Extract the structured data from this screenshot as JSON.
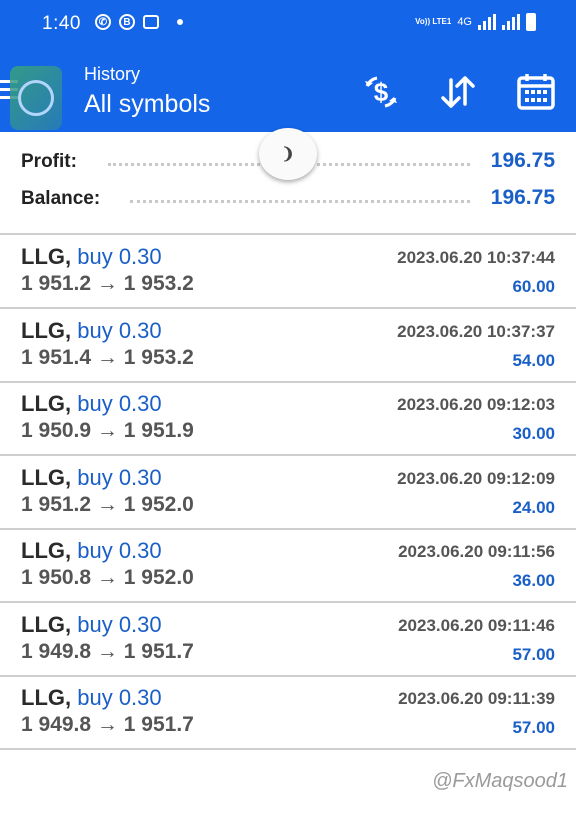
{
  "status_bar": {
    "time": "1:40",
    "network": "4G",
    "volte": "Vo)) LTE1"
  },
  "header": {
    "subtitle": "History",
    "title": "All symbols",
    "icons": [
      "menu-icon",
      "currency-exchange-icon",
      "sort-icon",
      "calendar-icon"
    ]
  },
  "summary": {
    "profit_label": "Profit:",
    "profit_value": "196.75",
    "balance_label": "Balance:",
    "balance_value": "196.75"
  },
  "trades": [
    {
      "symbol": "LLG,",
      "type": "buy 0.30",
      "open": "1 951.2",
      "close": "1 953.2",
      "time": "2023.06.20 10:37:44",
      "profit": "60.00"
    },
    {
      "symbol": "LLG,",
      "type": "buy 0.30",
      "open": "1 951.4",
      "close": "1 953.2",
      "time": "2023.06.20 10:37:37",
      "profit": "54.00"
    },
    {
      "symbol": "LLG,",
      "type": "buy 0.30",
      "open": "1 950.9",
      "close": "1 951.9",
      "time": "2023.06.20 09:12:03",
      "profit": "30.00"
    },
    {
      "symbol": "LLG,",
      "type": "buy 0.30",
      "open": "1 951.2",
      "close": "1 952.0",
      "time": "2023.06.20 09:12:09",
      "profit": "24.00"
    },
    {
      "symbol": "LLG,",
      "type": "buy 0.30",
      "open": "1 950.8",
      "close": "1 952.0",
      "time": "2023.06.20 09:11:56",
      "profit": "36.00"
    },
    {
      "symbol": "LLG,",
      "type": "buy 0.30",
      "open": "1 949.8",
      "close": "1 951.7",
      "time": "2023.06.20 09:11:46",
      "profit": "57.00"
    },
    {
      "symbol": "LLG,",
      "type": "buy 0.30",
      "open": "1 949.8",
      "close": "1 951.7",
      "time": "2023.06.20 09:11:39",
      "profit": "57.00"
    }
  ],
  "arrow": "→",
  "watermark": "@FxMaqsood1",
  "colors": {
    "header": "#1565e8",
    "accent": "#1a5fc7",
    "text": "#2b2b2b"
  }
}
